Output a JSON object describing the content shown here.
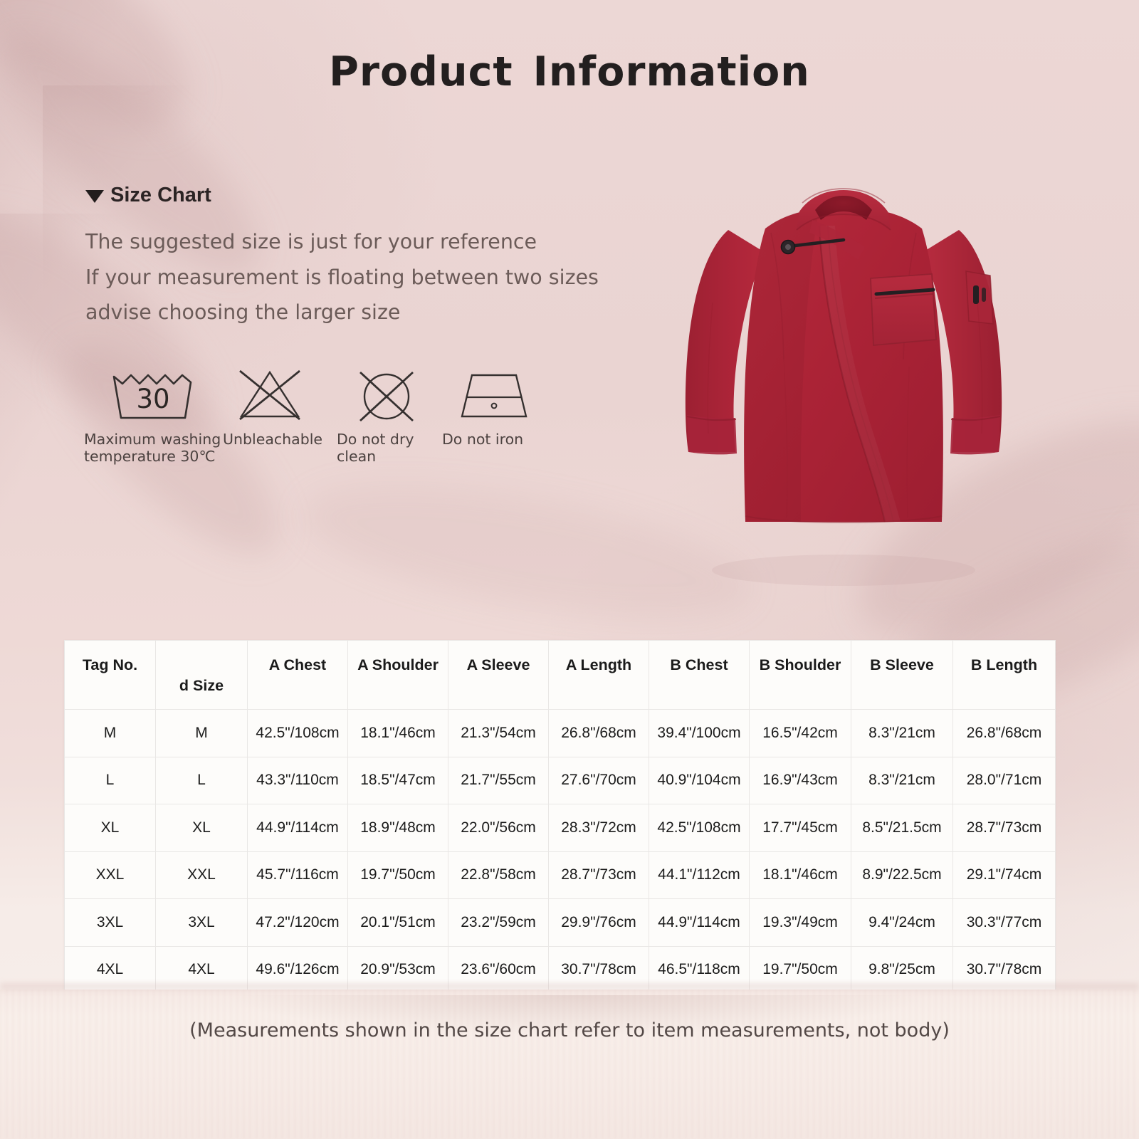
{
  "header": {
    "title_part1": "Product",
    "title_part2": "Information"
  },
  "size_chart": {
    "heading": "Size Chart",
    "caret_icon": "triangle-down-icon",
    "lines": [
      "The suggested size is just for your reference",
      "If your measurement is floating between two sizes",
      "advise choosing the larger size"
    ]
  },
  "care_symbols": [
    {
      "icon": "wash-tub-30-icon",
      "value": "30",
      "label_line1": "Maximum washing",
      "label_line2": "temperature 30℃"
    },
    {
      "icon": "no-bleach-triangle-icon",
      "label_line1": "Unbleachable",
      "label_line2": ""
    },
    {
      "icon": "no-dry-clean-circle-icon",
      "label_line1": "Do not dry clean",
      "label_line2": ""
    },
    {
      "icon": "no-iron-icon",
      "label_line1": "Do not iron",
      "label_line2": ""
    }
  ],
  "product_image": {
    "name": "red-chef-jacket",
    "color": "#b02436",
    "accent": "#2a2326"
  },
  "table": {
    "columns": [
      "Tag No.",
      "d Size",
      "A Chest",
      "A Shoulder",
      "A Sleeve",
      "A Length",
      "B Chest",
      "B Shoulder",
      "B Sleeve",
      "B Length"
    ],
    "rows": [
      [
        "M",
        "M",
        "42.5\"/108cm",
        "18.1\"/46cm",
        "21.3\"/54cm",
        "26.8\"/68cm",
        "39.4\"/100cm",
        "16.5\"/42cm",
        "8.3\"/21cm",
        "26.8\"/68cm"
      ],
      [
        "L",
        "L",
        "43.3\"/110cm",
        "18.5\"/47cm",
        "21.7\"/55cm",
        "27.6\"/70cm",
        "40.9\"/104cm",
        "16.9\"/43cm",
        "8.3\"/21cm",
        "28.0\"/71cm"
      ],
      [
        "XL",
        "XL",
        "44.9\"/114cm",
        "18.9\"/48cm",
        "22.0\"/56cm",
        "28.3\"/72cm",
        "42.5\"/108cm",
        "17.7\"/45cm",
        "8.5\"/21.5cm",
        "28.7\"/73cm"
      ],
      [
        "XXL",
        "XXL",
        "45.7\"/116cm",
        "19.7\"/50cm",
        "22.8\"/58cm",
        "28.7\"/73cm",
        "44.1\"/112cm",
        "18.1\"/46cm",
        "8.9\"/22.5cm",
        "29.1\"/74cm"
      ],
      [
        "3XL",
        "3XL",
        "47.2\"/120cm",
        "20.1\"/51cm",
        "23.2\"/59cm",
        "29.9\"/76cm",
        "44.9\"/114cm",
        "19.3\"/49cm",
        "9.4\"/24cm",
        "30.3\"/77cm"
      ],
      [
        "4XL",
        "4XL",
        "49.6\"/126cm",
        "20.9\"/53cm",
        "23.6\"/60cm",
        "30.7\"/78cm",
        "46.5\"/118cm",
        "19.7\"/50cm",
        "9.8\"/25cm",
        "30.7\"/78cm"
      ]
    ]
  },
  "footnote": "(Measurements shown in the size chart refer to item measurements, not body)",
  "colors": {
    "background_top": "#ead4d2",
    "background_bottom": "#f7ece8",
    "text_dark": "#231f1f",
    "text_muted": "#6b5b58",
    "table_border": "#e9e7e5",
    "table_bg": "#fdfcfa"
  }
}
